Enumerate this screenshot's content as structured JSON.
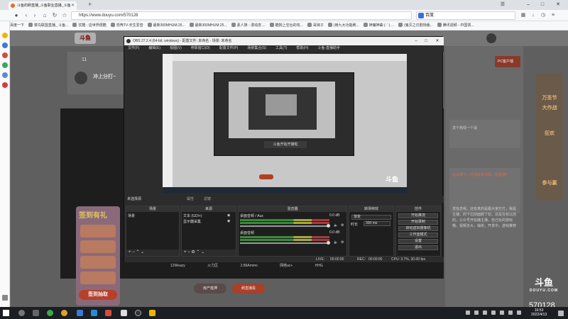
{
  "browser": {
    "tab_title": "斗鱼的刷直播_斗鱼职业直播_斗鱼",
    "new_tab": "+",
    "url": "https://www.douyu.com/570128",
    "search_engine": "百度",
    "bookmarks": [
      "百度一下",
      "菜鸟联盟直播_ 斗鱼...",
      "优酷 - 这世界很酷",
      "恐怖TV-天生爱音",
      "最新300MHUM.25...",
      "最新300MHUM.25...",
      "素人族 - 漫动态 ...",
      "酷狗上空台的攻...",
      "哥妹子",
      "(用九大功能刷...",
      "神魔神曲 (·ˉ·) ...",
      "(鬼灭之刃剧场版...",
      "腾讯视频 - 中国领..."
    ]
  },
  "page": {
    "left_num": "11",
    "left_title": "冲上分打~",
    "promo_title": "签到有礼",
    "promo_cta": "签到抽取",
    "stats": [
      "12Weazy",
      "火力区",
      "2.89Ammo",
      "网络ac+",
      "HHG"
    ],
    "btn_left": "房产抵押",
    "btn_right": "刷直播看",
    "right_col": {
      "pc_btn": "PC客户端",
      "chat_lines": [
        "发个热情一个请",
        "这么晚了，还没有写代码，刷直播？",
        "发信息呢，还有真的是跟大家打打，我是主播，的下边前面刷了玩，这是在有以前的，公众号开始播主播，自己玩的游戏哦，视频多大，抽奖，开发中，游戏推荐送出，快乐游戏呢，优惠多多，礼物多多"
      ],
      "bottom_lines": [
        "主播是否直播完毕的，发现直播只回复主播那么，会发现直播中关注，写到本主播出现设施，主播公演中，在主"
      ]
    },
    "ad_lines": [
      "万圣节",
      "大作战",
      "狂欢",
      "参与赢"
    ],
    "douyu_logo": "斗鱼",
    "douyu_sub": "DOUYU.COM",
    "room_id": "570128"
  },
  "obs": {
    "title": "OBS 27.2.4 (64-bit, windows) - 配置文件: 未命名 - 场景: 未命名",
    "menu": [
      "文件(F)",
      "编辑(E)",
      "视图(V)",
      "停靠窗口(D)",
      "配置文件(P)",
      "场景集合(S)",
      "工具(T)",
      "帮助(H)",
      "斗鱼-直播助手"
    ],
    "preview_label": "斗鱼开始开播啦",
    "scene_bar": {
      "no_source": "未选择源",
      "props": "属性",
      "filter": "滤镜"
    },
    "docks": {
      "scenes": {
        "title": "场景",
        "items": [
          "场景"
        ]
      },
      "sources": {
        "title": "来源",
        "items": [
          "文本 (GDI+)",
          "显示器采集"
        ]
      },
      "mixer": {
        "title": "混音器",
        "tracks": [
          {
            "name": "桌面音频 / Aux",
            "db": "0.0 dB"
          },
          {
            "name": "桌面音频",
            "db": "0.0 dB"
          }
        ]
      },
      "transitions": {
        "title": "转场特效",
        "selected": "渐变",
        "duration_label": "时长",
        "duration": "300 ms"
      },
      "controls": {
        "title": "控件",
        "buttons": [
          "开始推流",
          "开始录制",
          "启动虚拟摄像机",
          "工作室模式",
          "设置",
          "退出"
        ]
      }
    },
    "status": {
      "live_label": "LIVE:",
      "live_time": "00:00:00",
      "rec_label": "REC:",
      "rec_time": "00:00:00",
      "cpu": "CPU: 3.7%, 30.00 fps"
    }
  },
  "taskbar": {
    "clock_time": "16:53",
    "clock_date": "2022/4/13"
  },
  "colors": {
    "accent": "#f06a1a",
    "douyu_red": "#b04020",
    "obs_bg": "#2c2c2c"
  }
}
